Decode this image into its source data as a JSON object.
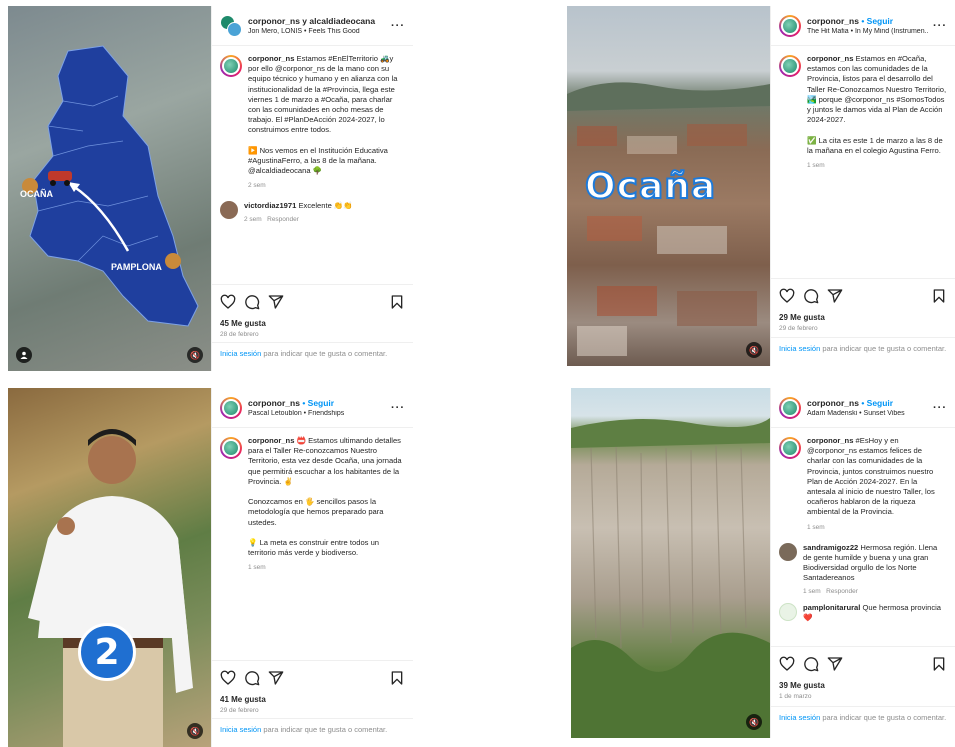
{
  "posts": [
    {
      "header_user": "corponor_ns y alcaldiadeocana",
      "header_follow": "",
      "song": "Jon Mero, LÒNIS • Feels This Good",
      "caption_user": "corponor_ns",
      "caption": "Estamos #EnElTerritorio 🚜y por ello @corponor_ns de la mano con su equipo técnico y humano y en alianza con la institucionalidad de la #Provincia, llega este viernes 1 de marzo a #Ocaña, para charlar con las comunidades en ocho mesas de trabajo. El #PlanDeAcción 2024-2027, lo construimos entre todos.\n\n▶️ Nos vemos en el Institución Educativa #AgustinaFerro, a las 8 de la mañana. @alcaldiadeocana 🌳",
      "caption_time": "2 sem",
      "comments": [
        {
          "user": "victordiaz1971",
          "text": "Excelente 👏👏",
          "time": "2 sem",
          "reply": "Responder"
        }
      ],
      "likes": "45 Me gusta",
      "date": "28 de febrero",
      "login_link": "Inicia sesión",
      "login_text": " para indicar que te gusta o comentar.",
      "map_label_1": "OCAÑA",
      "map_label_2": "PAMPLONA"
    },
    {
      "header_user": "corponor_ns",
      "header_follow": " • Seguir",
      "song": "The Hit Mafia • In My Mind (Instrumen...",
      "caption_user": "corponor_ns",
      "caption": "Estamos en #Ocaña, estamos con las comunidades de la Provincia, listos para el desarrollo del Taller Re-Conozcamos Nuestro Territorio, 🏞️ porque @corponor_ns #SomosTodos y juntos le damos vida al Plan de Acción 2024-2027.\n\n✅ La cita es este 1 de marzo a las 8 de la mañana en el colegio Agustina Ferro.",
      "caption_time": "1 sem",
      "comments": [],
      "likes": "29 Me gusta",
      "date": "29 de febrero",
      "login_link": "Inicia sesión",
      "login_text": " para indicar que te gusta o comentar.",
      "overlay_title": "Ocaña"
    },
    {
      "header_user": "corponor_ns",
      "header_follow": " • Seguir",
      "song": "Pascal Letoublon • Friendships",
      "caption_user": "corponor_ns",
      "caption": "📛 Estamos ultimando detalles para el Taller Re-conozcamos Nuestro Territorio, esta vez desde Ocaña, una jornada que permitirá escuchar a los habitantes de la Provincia. ✌️\n\nConozcamos en 🖐️ sencillos pasos la metodología que hemos preparado para ustedes.\n\n💡 La meta es construir entre todos un territorio más verde y biodiverso.",
      "caption_time": "1 sem",
      "comments": [],
      "likes": "41 Me gusta",
      "date": "29 de febrero",
      "login_link": "Inicia sesión",
      "login_text": " para indicar que te gusta o comentar.",
      "overlay_number": "2"
    },
    {
      "header_user": "corponor_ns",
      "header_follow": " • Seguir",
      "song": "Adam Madenski • Sunset Vibes",
      "caption_user": "corponor_ns",
      "caption": "#EsHoy y en @corponor_ns estamos felices de charlar con las comunidades de la Provincia, juntos construimos nuestro Plan de Acción 2024-2027. En la antesala al inicio de nuestro Taller, los ocañeros hablaron de la riqueza ambiental de la Provincia.",
      "caption_time": "1 sem",
      "comments": [
        {
          "user": "sandramigoz22",
          "text": "Hermosa región. Llena de gente humilde y buena y una gran Biodiversidad orgullo de los Norte Santadereanos",
          "time": "1 sem",
          "reply": "Responder"
        },
        {
          "user": "pamplonitarural",
          "text": "Que hermosa provincia ❤️",
          "time": "",
          "reply": ""
        }
      ],
      "likes": "39 Me gusta",
      "date": "1 de marzo",
      "login_link": "Inicia sesión",
      "login_text": " para indicar que te gusta o comentar."
    }
  ]
}
